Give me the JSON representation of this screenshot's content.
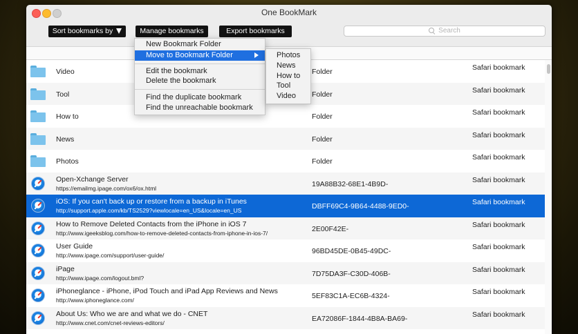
{
  "window": {
    "title": "One BookMark"
  },
  "toolbar": {
    "sort_label": "Sort bookmarks by",
    "manage_label": "Manage bookmarks",
    "export_label": "Export bookmarks",
    "search_placeholder": "Search"
  },
  "menu": {
    "items": [
      "New Bookmark Folder",
      "Move to Bookmark Folder",
      "Edit the bookmark",
      "Delete the bookmark",
      "Find the duplicate bookmark",
      "Find the unreachable bookmark"
    ],
    "submenu": [
      "Photos",
      "News",
      "How to",
      "Tool",
      "Video"
    ]
  },
  "rows": [
    {
      "type": "folder",
      "name": "Video",
      "col2": "Folder",
      "col3": "Safari bookmark"
    },
    {
      "type": "folder",
      "name": "Tool",
      "col2": "Folder",
      "col3": "Safari bookmark"
    },
    {
      "type": "folder",
      "name": "How to",
      "col2": "Folder",
      "col3": "Safari bookmark"
    },
    {
      "type": "folder",
      "name": "News",
      "col2": "Folder",
      "col3": "Safari bookmark"
    },
    {
      "type": "folder",
      "name": "Photos",
      "col2": "Folder",
      "col3": "Safari bookmark"
    },
    {
      "type": "bookmark",
      "title": "Open-Xchange Server",
      "url": "https://emailmg.ipage.com/ox6/ox.html",
      "col2": "19A88B32-68E1-4B9D-",
      "col3": "Safari bookmark"
    },
    {
      "type": "bookmark",
      "title": "iOS: If you can't back up or restore from a backup in iTunes",
      "url": "http://support.apple.com/kb/TS2529?viewlocale=en_US&locale=en_US",
      "col2": "DBFF69C4-9B64-4488-9ED0-",
      "col3": "Safari bookmark",
      "selected": true
    },
    {
      "type": "bookmark",
      "title": "How to Remove Deleted Contacts from the iPhone in iOS 7",
      "url": "http://www.igeeksblog.com/how-to-remove-deleted-contacts-from-iphone-in-ios-7/",
      "col2": "2E00F42E-",
      "col3": "Safari bookmark"
    },
    {
      "type": "bookmark",
      "title": "User Guide",
      "url": "http://www.ipage.com/support/user-guide/",
      "col2": "96BD45DE-0B45-49DC-",
      "col3": "Safari bookmark"
    },
    {
      "type": "bookmark",
      "title": "iPage",
      "url": "http://www.ipage.com/logout.bml?",
      "col2": "7D75DA3F-C30D-406B-",
      "col3": "Safari bookmark"
    },
    {
      "type": "bookmark",
      "title": "iPhoneglance - iPhone, iPod Touch and iPad App Reviews and News",
      "url": "http://www.iphoneglance.com/",
      "col2": "5EF83C1A-EC6B-4324-",
      "col3": "Safari bookmark"
    },
    {
      "type": "bookmark",
      "title": "About Us: Who we are and what we do - CNET",
      "url": "http://www.cnet.com/cnet-reviews-editors/",
      "col2": "EA72086F-1844-4B8A-BA69-",
      "col3": "Safari bookmark"
    }
  ]
}
